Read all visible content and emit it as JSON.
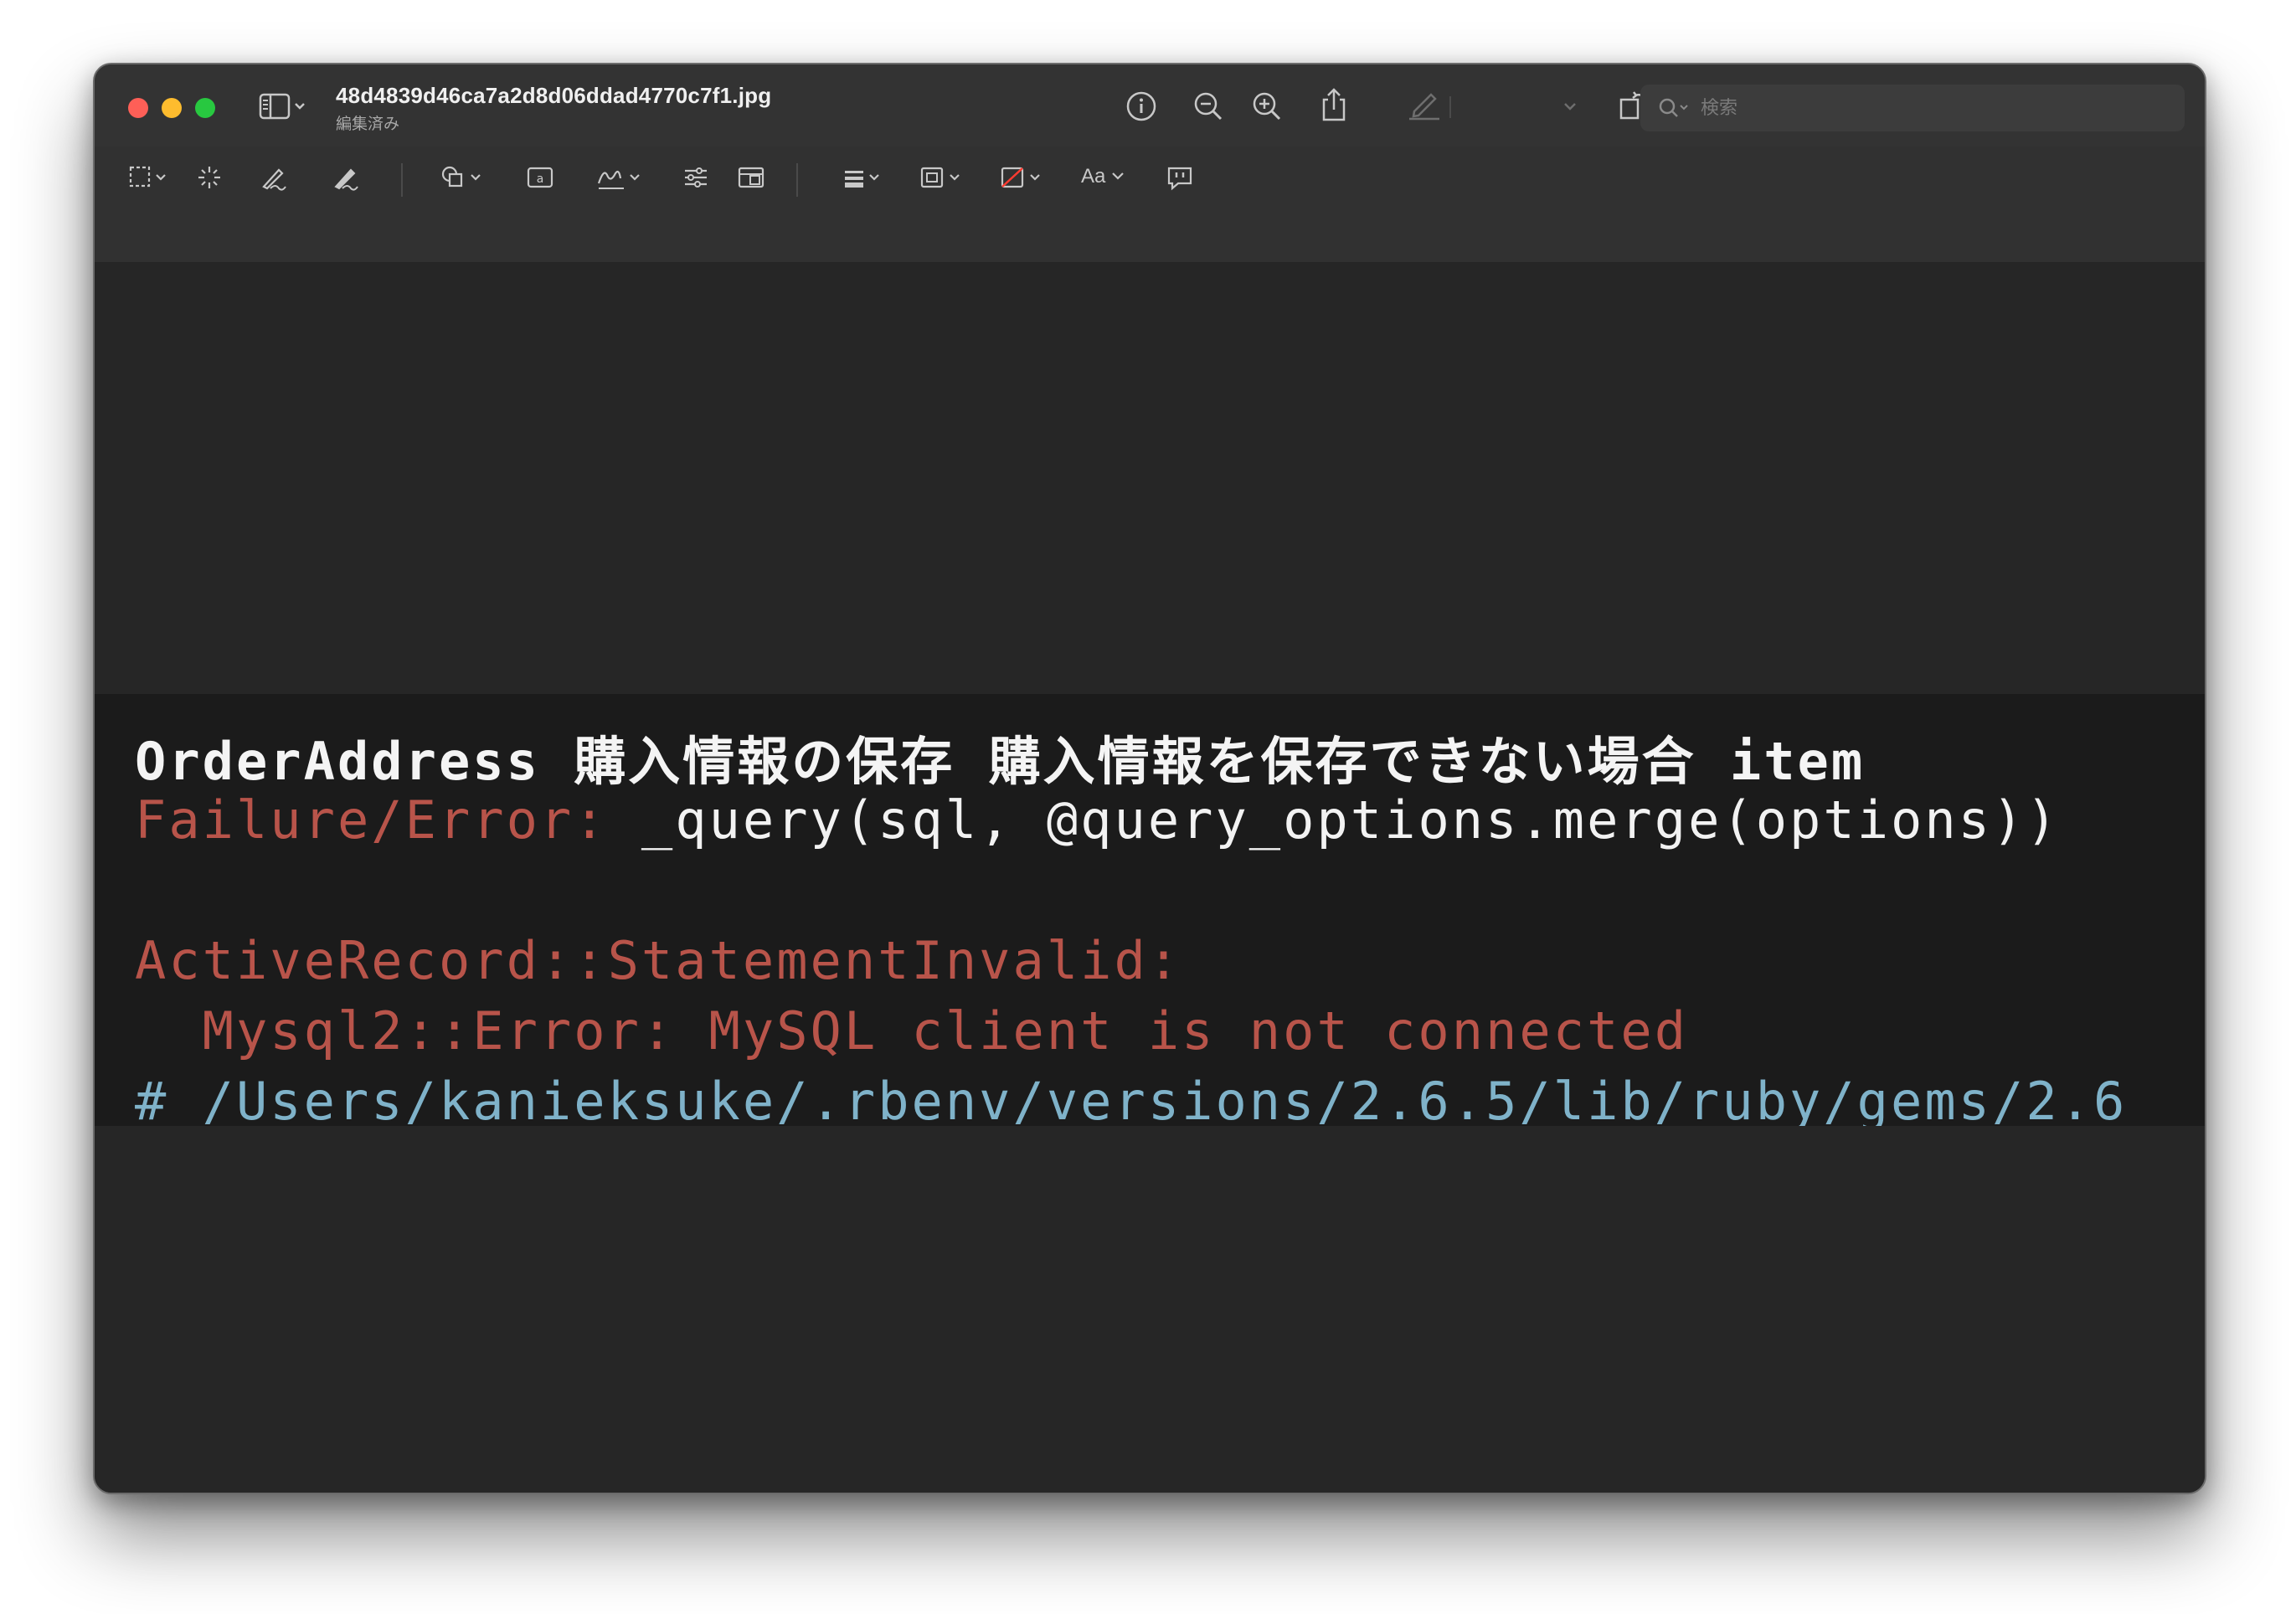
{
  "window": {
    "title": "48d4839d46ca7a2d8d06ddad4770c7f1.jpg",
    "subtitle": "編集済み"
  },
  "toolbar": {
    "icons": [
      "sidebar-icon",
      "info-icon",
      "zoom-out-icon",
      "zoom-in-icon",
      "share-icon",
      "highlight-pen-icon",
      "rotate-icon",
      "markup-icon"
    ]
  },
  "search": {
    "placeholder": "検索"
  },
  "markup_toolbar": {
    "icons": [
      "selection-icon",
      "instant-alpha-icon",
      "sketch-icon",
      "draw-icon",
      "shapes-icon",
      "text-box-icon",
      "sign-icon",
      "adjust-color-icon",
      "adjust-size-icon",
      "shape-style-icon",
      "border-color-icon",
      "fill-color-icon",
      "text-style-icon",
      "annotate-icon"
    ],
    "text_style_label": "Aa"
  },
  "document": {
    "line1": "OrderAddress 購入情報の保存 購入情報を保存できない場合 item",
    "line2_error": "Failure/Error: ",
    "line2_code": "_query(sql, @query_options.merge(options))",
    "line4": "ActiveRecord::StatementInvalid:",
    "line5": "  Mysql2::Error: MySQL client is not connected",
    "line6": "# /Users/kanieksuke/.rbenv/versions/2.6.5/lib/ruby/gems/2.6"
  },
  "colors": {
    "error_red": "#b8544a",
    "path_blue": "#7fb2c9",
    "accent_blue": "#3b82f6"
  }
}
